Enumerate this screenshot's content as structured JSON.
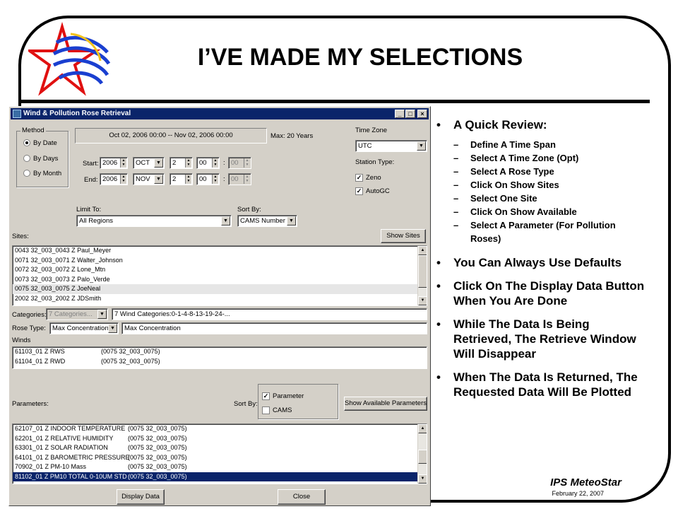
{
  "slide": {
    "title": "I’VE MADE MY SELECTIONS",
    "brand": "IPS MeteoStar",
    "date": "February 22, 2007"
  },
  "bullets": {
    "review_heading": "A Quick Review:",
    "review_items": [
      "Define A Time Span",
      "Select A Time Zone (Opt)",
      "Select A Rose Type",
      "Click On Show Sites",
      "Select One Site",
      "Click On Show Available",
      "Select A Parameter (For Pollution Roses)"
    ],
    "points": [
      "You Can Always Use Defaults",
      "Click On The Display Data Button When You Are Done",
      "While The Data Is Being Retrieved, The Retrieve Window Will Disappear",
      "When The Data Is Returned, The Requested Data Will Be Plotted"
    ]
  },
  "window": {
    "title": "Wind & Pollution Rose Retrieval",
    "controls": {
      "minimize": "_",
      "maximize": "□",
      "close": "×"
    },
    "method": {
      "label": "Method",
      "options": [
        "By Date",
        "By Days",
        "By Month"
      ],
      "selected": "By Date"
    },
    "range_display": "Oct 02, 2006 00:00 -- Nov 02, 2006 00:00",
    "max_label": "Max: 20 Years",
    "start": {
      "label": "Start:",
      "year": "2006",
      "month": "OCT",
      "day": "2",
      "hour": "00",
      "minute": "00"
    },
    "end": {
      "label": "End:",
      "year": "2006",
      "month": "NOV",
      "day": "2",
      "hour": "00",
      "minute": "00"
    },
    "colon": ":",
    "time_zone": {
      "label": "Time Zone",
      "value": "UTC"
    },
    "station_type": {
      "label": "Station Type:",
      "zeno": "Zeno",
      "autogc": "AutoGC",
      "checkmark": "✓"
    },
    "limit_to": {
      "label": "Limit To:",
      "value": "All Regions"
    },
    "sort_by": {
      "label": "Sort By:",
      "value": "CAMS Number"
    },
    "sites": {
      "label": "Sites:",
      "button": "Show Sites",
      "rows": [
        "0043 32_003_0043 Z Paul_Meyer",
        "0071 32_003_0071 Z Walter_Johnson",
        "0072 32_003_0072 Z Lone_Mtn",
        "0073 32_003_0073 Z Palo_Verde",
        "0075 32_003_0075 Z JoeNeal",
        "2002 32_003_2002 Z JDSmith"
      ],
      "selected_index": 4
    },
    "categories": {
      "label": "Categories:",
      "value": "7 Categories...",
      "detail": "7 Wind Categories:0-1-4-8-13-19-24-..."
    },
    "rose_type": {
      "label": "Rose Type:",
      "value": "Max Concentration",
      "detail": "Max Concentration"
    },
    "winds": {
      "label": "Winds",
      "rows": [
        {
          "name": "61103_01 Z RWS",
          "site": "(0075 32_003_0075)"
        },
        {
          "name": "61104_01 Z RWD",
          "site": "(0075 32_003_0075)"
        }
      ]
    },
    "parameters": {
      "label": "Parameters:",
      "sort_by": "Sort By:",
      "sort_options": {
        "parameter": "Parameter",
        "cams": "CAMS"
      },
      "button": "Show Available Parameters",
      "rows": [
        {
          "name": "62107_01 Z INDOOR TEMPERATURE",
          "site": "(0075 32_003_0075)"
        },
        {
          "name": "62201_01 Z RELATIVE HUMIDITY",
          "site": "(0075 32_003_0075)"
        },
        {
          "name": "63301_01 Z SOLAR RADIATION",
          "site": "(0075 32_003_0075)"
        },
        {
          "name": "64101_01 Z BAROMETRIC PRESSURE",
          "site": "(0075 32_003_0075)"
        },
        {
          "name": "70902_01 Z PM-10 Mass",
          "site": "(0075 32_003_0075)"
        },
        {
          "name": "81102_01 Z PM10 TOTAL 0-10UM STD",
          "site": "(0075 32_003_0075)"
        }
      ],
      "selected_index": 5
    },
    "display_button": "Display Data",
    "close_button": "Close"
  }
}
